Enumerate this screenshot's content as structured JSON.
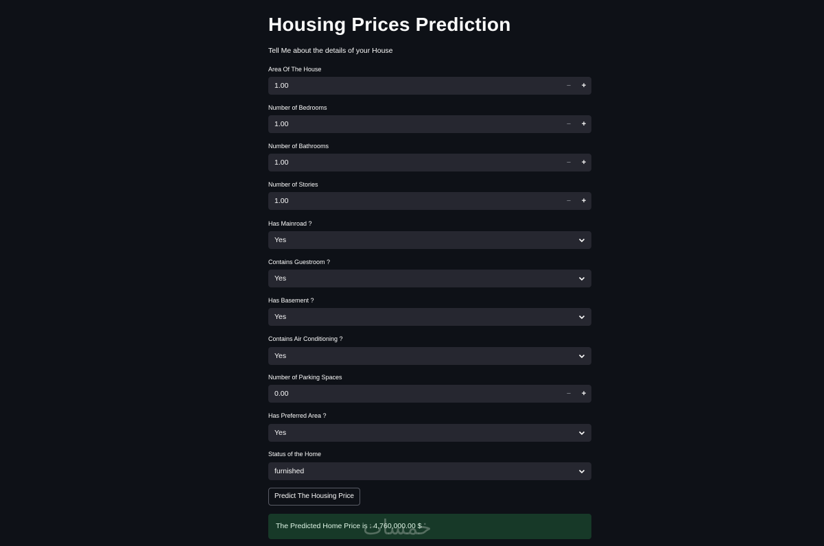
{
  "page": {
    "title": "Housing Prices Prediction",
    "subtitle": "Tell Me about the details of your House"
  },
  "fields": {
    "area": {
      "label": "Area Of The House",
      "value": "1.00"
    },
    "bedrooms": {
      "label": "Number of Bedrooms",
      "value": "1.00"
    },
    "bathrooms": {
      "label": "Number of Bathrooms",
      "value": "1.00"
    },
    "stories": {
      "label": "Number of Stories",
      "value": "1.00"
    },
    "mainroad": {
      "label": "Has Mainroad ?",
      "value": "Yes"
    },
    "guestroom": {
      "label": "Contains Guestroom ?",
      "value": "Yes"
    },
    "basement": {
      "label": "Has Basement ?",
      "value": "Yes"
    },
    "aircon": {
      "label": "Contains Air Conditioning ?",
      "value": "Yes"
    },
    "parking": {
      "label": "Number of Parking Spaces",
      "value": "0.00"
    },
    "prefarea": {
      "label": "Has Preferred Area ?",
      "value": "Yes"
    },
    "furnishing": {
      "label": "Status of the Home",
      "value": "furnished"
    }
  },
  "stepper": {
    "minus": "−",
    "plus": "+"
  },
  "icons": {
    "chevron": "chevron-down-icon",
    "stepper_minus": "minus-icon",
    "stepper_plus": "plus-icon"
  },
  "predict_button": {
    "label": "Predict The Housing Price"
  },
  "result": {
    "text": "The Predicted Home Price is : 4,760,000.00 $"
  },
  "watermark": {
    "text": "خمسات"
  },
  "colors": {
    "background": "#0e1117",
    "input_bg": "#262730",
    "success_bg": "#173928",
    "text": "#fafafa"
  }
}
